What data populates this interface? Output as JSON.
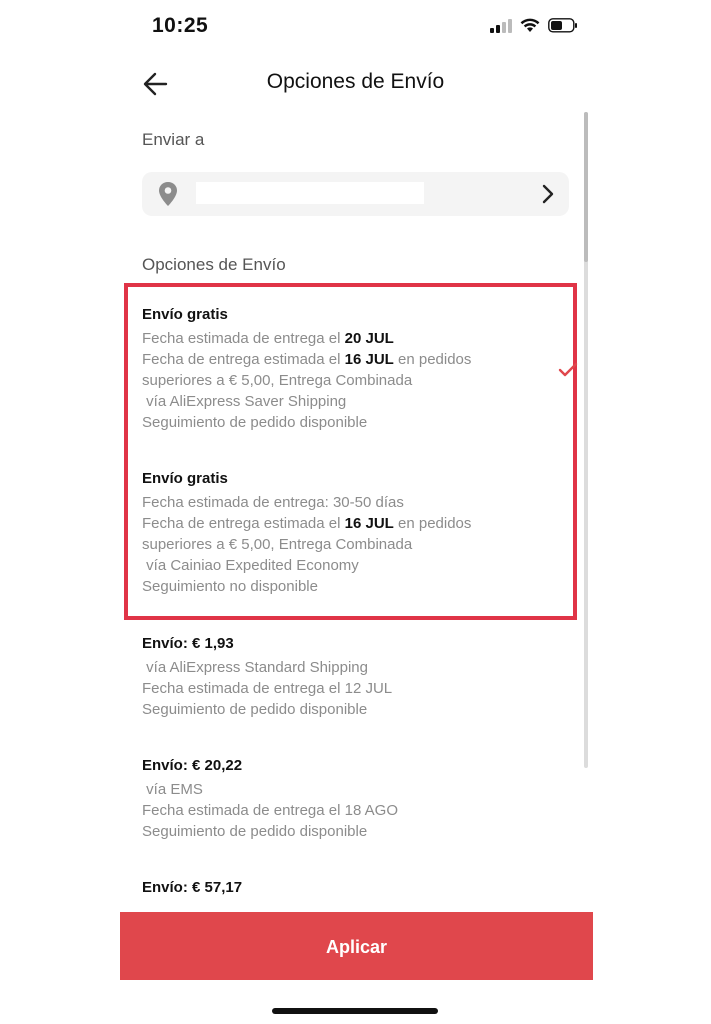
{
  "status_bar": {
    "time": "10:25",
    "icons": [
      "signal-icon",
      "wifi-icon",
      "battery-icon"
    ]
  },
  "header": {
    "title": "Opciones de Envío",
    "back_icon": "back-arrow-icon"
  },
  "ship_to": {
    "label": "Enviar a",
    "icon": "location-pin-icon",
    "address": "",
    "chevron_icon": "chevron-right-icon"
  },
  "options_label": "Opciones de Envío",
  "options": [
    {
      "title": "Envío gratis",
      "selected": true,
      "line1_a": "Fecha estimada de entrega el ",
      "line1_b": "20 JUL",
      "line2_a": "Fecha de entrega estimada el ",
      "line2_b": "16 JUL",
      "line2_c": " en pedidos",
      "line3": "superiores a € 5,00, Entrega Combinada",
      "line4": " vía AliExpress Saver Shipping",
      "line5": "Seguimiento de pedido disponible"
    },
    {
      "title": "Envío gratis",
      "selected": false,
      "line1": "Fecha estimada de entrega: 30-50 días",
      "line2_a": "Fecha de entrega estimada el ",
      "line2_b": "16 JUL",
      "line2_c": " en pedidos",
      "line3": "superiores a € 5,00, Entrega Combinada",
      "line4": " vía Cainiao Expedited Economy",
      "line5": "Seguimiento no disponible"
    },
    {
      "title": "Envío: € 1,93",
      "selected": false,
      "line1": " vía AliExpress Standard Shipping",
      "line2": "Fecha estimada de entrega el 12 JUL",
      "line3": "Seguimiento de pedido disponible"
    },
    {
      "title": "Envío: € 20,22",
      "selected": false,
      "line1": " vía EMS",
      "line2": "Fecha estimada de entrega el 18 AGO",
      "line3": "Seguimiento de pedido disponible"
    },
    {
      "title": "Envío: € 57,17",
      "selected": false
    }
  ],
  "apply_label": "Aplicar",
  "colors": {
    "accent": "#e0474c",
    "highlight_border": "#e03447",
    "check": "#e0474c"
  }
}
